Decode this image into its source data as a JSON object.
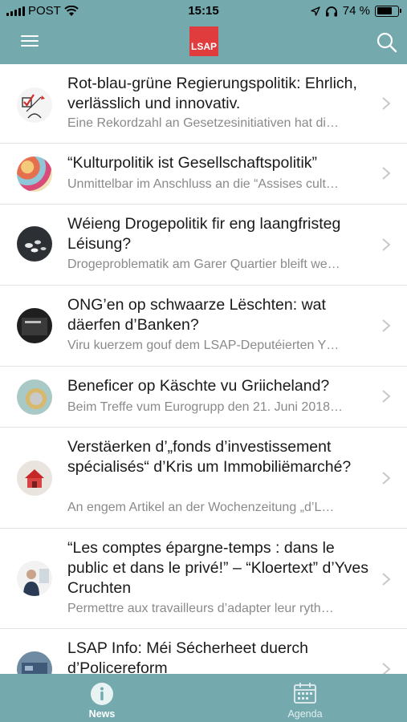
{
  "status_bar": {
    "carrier": "POST",
    "time": "15:15",
    "battery_percent": "74 %",
    "battery_level": 0.74,
    "icons": [
      "signal-icon",
      "wifi-icon",
      "location-icon",
      "headphones-icon",
      "battery-icon"
    ]
  },
  "header": {
    "logo_text": "LSAP",
    "background_color": "#74a9ae",
    "logo_color": "#e03c3d",
    "icons": [
      "hamburger-menu-icon",
      "search-icon"
    ]
  },
  "articles": [
    {
      "title": "Rot-blau-grüne Regierungspolitik: Ehrlich, verlässlich und innovativ.",
      "excerpt": "Eine Rekordzahl an Gesetzesinitiativen hat di…",
      "image": "ballot-checkmark-icon"
    },
    {
      "title": "“Kulturpolitik ist Gesellschaftspolitik”",
      "excerpt": "Unmittelbar im Anschluss an die “Assises cult…",
      "image": "colorful-beads-photo"
    },
    {
      "title": "Wéieng Drogepolitik fir eng laangfristeg Léisung?",
      "excerpt": "Drogeproblematik am Garer Quartier bleift we…",
      "image": "pills-photo"
    },
    {
      "title": "ONG’en op schwaarze Lëschten: wat däerfen d’Banken?",
      "excerpt": "Viru kuerzem gouf dem LSAP-Deputéierten Y…",
      "image": "dark-notebook-photo"
    },
    {
      "title": "Beneficer op Käschte vu Griicheland?",
      "excerpt": "Beim Treffe vum Eurogrupp den 21. Juni 2018…",
      "image": "euro-coin-photo"
    },
    {
      "title": "Verstäerken d’„fonds d’investissement spécialisés“ d’Kris um Immobiliëmarché?",
      "excerpt": "An engem Artikel an der Wochenzeitung „d’L…",
      "image": "red-house-photo"
    },
    {
      "title": "“Les comptes épargne-temps : dans le public et dans le privé!” – “Kloertext” d’Yves Cruchten",
      "excerpt": "Permettre aux travailleurs d’adapter leur ryth…",
      "image": "speaker-portrait-photo"
    },
    {
      "title": "LSAP Info: Méi Sécherheet duerch d’Policereform",
      "excerpt": "",
      "image": "police-photo"
    }
  ],
  "tab_bar": {
    "tabs": [
      {
        "label": "News",
        "icon": "info-circle-icon",
        "active": true
      },
      {
        "label": "Agenda",
        "icon": "calendar-icon",
        "active": false
      }
    ]
  }
}
